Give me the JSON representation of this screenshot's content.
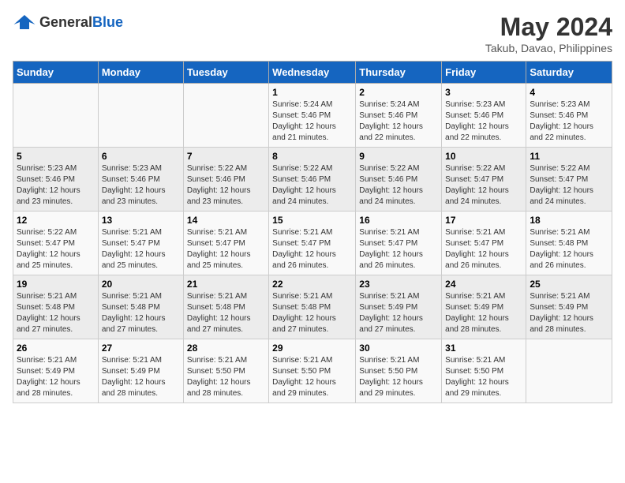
{
  "header": {
    "logo_general": "General",
    "logo_blue": "Blue",
    "title": "May 2024",
    "subtitle": "Takub, Davao, Philippines"
  },
  "columns": [
    "Sunday",
    "Monday",
    "Tuesday",
    "Wednesday",
    "Thursday",
    "Friday",
    "Saturday"
  ],
  "weeks": [
    [
      {
        "day": "",
        "info": ""
      },
      {
        "day": "",
        "info": ""
      },
      {
        "day": "",
        "info": ""
      },
      {
        "day": "1",
        "info": "Sunrise: 5:24 AM\nSunset: 5:46 PM\nDaylight: 12 hours\nand 21 minutes."
      },
      {
        "day": "2",
        "info": "Sunrise: 5:24 AM\nSunset: 5:46 PM\nDaylight: 12 hours\nand 22 minutes."
      },
      {
        "day": "3",
        "info": "Sunrise: 5:23 AM\nSunset: 5:46 PM\nDaylight: 12 hours\nand 22 minutes."
      },
      {
        "day": "4",
        "info": "Sunrise: 5:23 AM\nSunset: 5:46 PM\nDaylight: 12 hours\nand 22 minutes."
      }
    ],
    [
      {
        "day": "5",
        "info": "Sunrise: 5:23 AM\nSunset: 5:46 PM\nDaylight: 12 hours\nand 23 minutes."
      },
      {
        "day": "6",
        "info": "Sunrise: 5:23 AM\nSunset: 5:46 PM\nDaylight: 12 hours\nand 23 minutes."
      },
      {
        "day": "7",
        "info": "Sunrise: 5:22 AM\nSunset: 5:46 PM\nDaylight: 12 hours\nand 23 minutes."
      },
      {
        "day": "8",
        "info": "Sunrise: 5:22 AM\nSunset: 5:46 PM\nDaylight: 12 hours\nand 24 minutes."
      },
      {
        "day": "9",
        "info": "Sunrise: 5:22 AM\nSunset: 5:46 PM\nDaylight: 12 hours\nand 24 minutes."
      },
      {
        "day": "10",
        "info": "Sunrise: 5:22 AM\nSunset: 5:47 PM\nDaylight: 12 hours\nand 24 minutes."
      },
      {
        "day": "11",
        "info": "Sunrise: 5:22 AM\nSunset: 5:47 PM\nDaylight: 12 hours\nand 24 minutes."
      }
    ],
    [
      {
        "day": "12",
        "info": "Sunrise: 5:22 AM\nSunset: 5:47 PM\nDaylight: 12 hours\nand 25 minutes."
      },
      {
        "day": "13",
        "info": "Sunrise: 5:21 AM\nSunset: 5:47 PM\nDaylight: 12 hours\nand 25 minutes."
      },
      {
        "day": "14",
        "info": "Sunrise: 5:21 AM\nSunset: 5:47 PM\nDaylight: 12 hours\nand 25 minutes."
      },
      {
        "day": "15",
        "info": "Sunrise: 5:21 AM\nSunset: 5:47 PM\nDaylight: 12 hours\nand 26 minutes."
      },
      {
        "day": "16",
        "info": "Sunrise: 5:21 AM\nSunset: 5:47 PM\nDaylight: 12 hours\nand 26 minutes."
      },
      {
        "day": "17",
        "info": "Sunrise: 5:21 AM\nSunset: 5:47 PM\nDaylight: 12 hours\nand 26 minutes."
      },
      {
        "day": "18",
        "info": "Sunrise: 5:21 AM\nSunset: 5:48 PM\nDaylight: 12 hours\nand 26 minutes."
      }
    ],
    [
      {
        "day": "19",
        "info": "Sunrise: 5:21 AM\nSunset: 5:48 PM\nDaylight: 12 hours\nand 27 minutes."
      },
      {
        "day": "20",
        "info": "Sunrise: 5:21 AM\nSunset: 5:48 PM\nDaylight: 12 hours\nand 27 minutes."
      },
      {
        "day": "21",
        "info": "Sunrise: 5:21 AM\nSunset: 5:48 PM\nDaylight: 12 hours\nand 27 minutes."
      },
      {
        "day": "22",
        "info": "Sunrise: 5:21 AM\nSunset: 5:48 PM\nDaylight: 12 hours\nand 27 minutes."
      },
      {
        "day": "23",
        "info": "Sunrise: 5:21 AM\nSunset: 5:49 PM\nDaylight: 12 hours\nand 27 minutes."
      },
      {
        "day": "24",
        "info": "Sunrise: 5:21 AM\nSunset: 5:49 PM\nDaylight: 12 hours\nand 28 minutes."
      },
      {
        "day": "25",
        "info": "Sunrise: 5:21 AM\nSunset: 5:49 PM\nDaylight: 12 hours\nand 28 minutes."
      }
    ],
    [
      {
        "day": "26",
        "info": "Sunrise: 5:21 AM\nSunset: 5:49 PM\nDaylight: 12 hours\nand 28 minutes."
      },
      {
        "day": "27",
        "info": "Sunrise: 5:21 AM\nSunset: 5:49 PM\nDaylight: 12 hours\nand 28 minutes."
      },
      {
        "day": "28",
        "info": "Sunrise: 5:21 AM\nSunset: 5:50 PM\nDaylight: 12 hours\nand 28 minutes."
      },
      {
        "day": "29",
        "info": "Sunrise: 5:21 AM\nSunset: 5:50 PM\nDaylight: 12 hours\nand 29 minutes."
      },
      {
        "day": "30",
        "info": "Sunrise: 5:21 AM\nSunset: 5:50 PM\nDaylight: 12 hours\nand 29 minutes."
      },
      {
        "day": "31",
        "info": "Sunrise: 5:21 AM\nSunset: 5:50 PM\nDaylight: 12 hours\nand 29 minutes."
      },
      {
        "day": "",
        "info": ""
      }
    ]
  ]
}
